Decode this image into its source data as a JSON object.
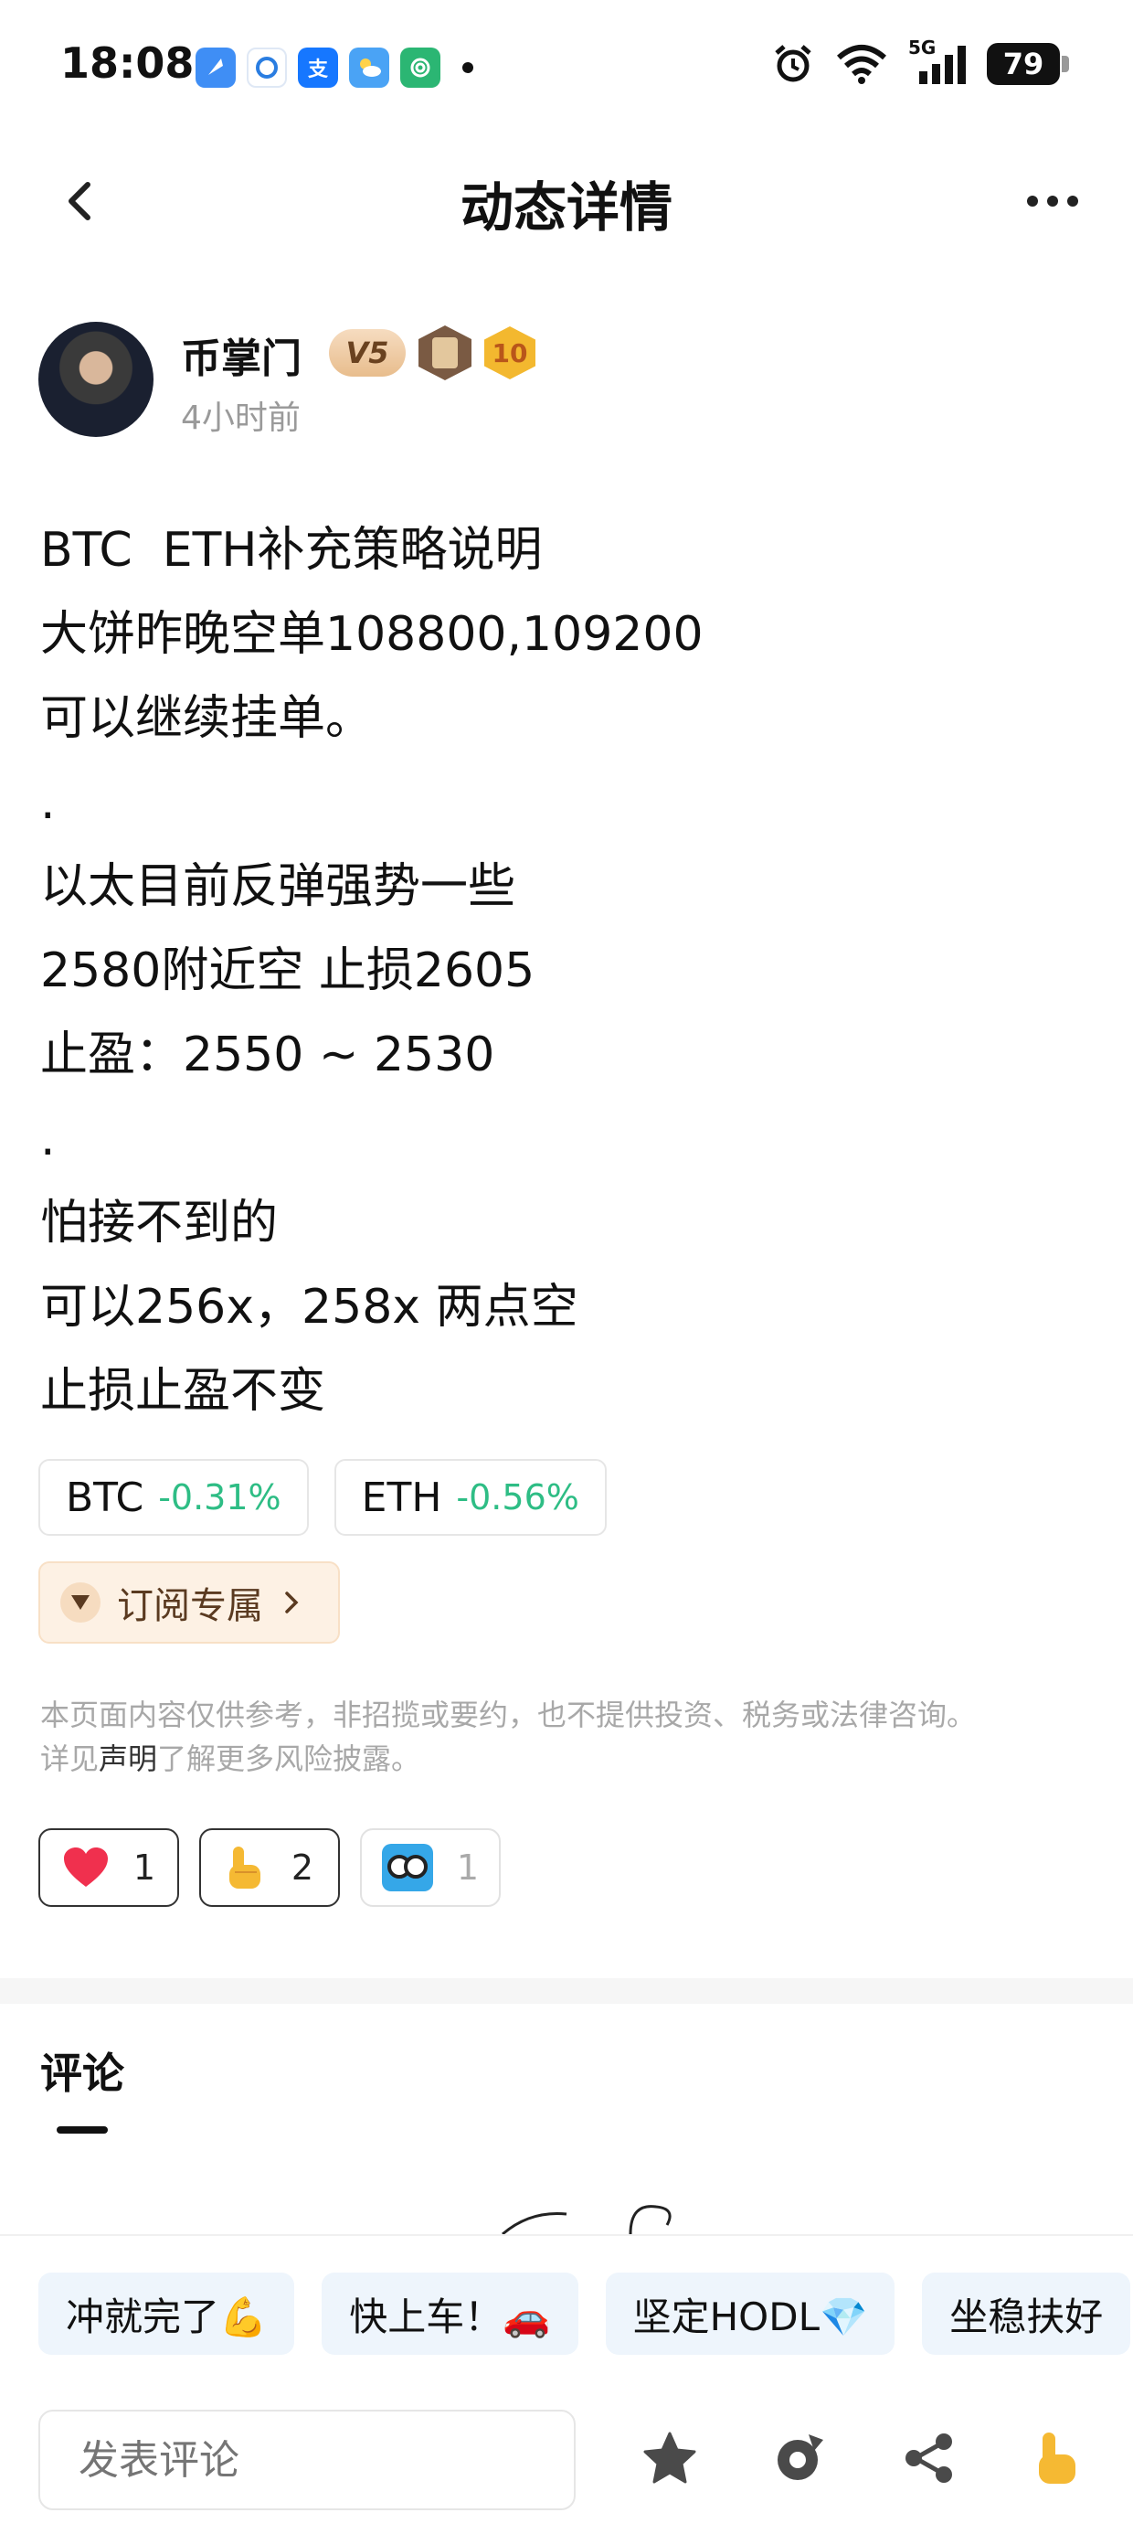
{
  "status_bar": {
    "time": "18:08",
    "battery": "79",
    "network": "5G",
    "app_icons": [
      "blue-feather-icon",
      "tongcheng-icon",
      "alipay-icon",
      "weather-icon",
      "fingerprint-icon"
    ]
  },
  "nav": {
    "title": "动态详情"
  },
  "author": {
    "name": "币掌门",
    "level_badge": "V5",
    "number_badge": "10",
    "time": "4小时前"
  },
  "post": {
    "lines": [
      "BTC  ETH补充策略说明",
      "大饼昨晚空单108800,109200",
      "可以继续挂单。",
      ".",
      "以太目前反弹强势一些",
      "2580附近空 止损2605",
      "止盈：2550 ~ 2530",
      ".",
      "怕接不到的",
      "可以256x，258x 两点空",
      "止损止盈不变"
    ]
  },
  "tickers": [
    {
      "symbol": "BTC",
      "change": "-0.31%"
    },
    {
      "symbol": "ETH",
      "change": "-0.56%"
    }
  ],
  "subscribe": {
    "label": "订阅专属"
  },
  "disclaimer": {
    "line1": "本页面内容仅供参考，非招揽或要约，也不提供投资、税务或法律咨询。",
    "line2_prefix": "详见",
    "line2_link": "声明",
    "line2_suffix": "了解更多风险披露。"
  },
  "reactions": [
    {
      "icon": "heart-icon",
      "count": "1"
    },
    {
      "icon": "thumbs-up-icon",
      "count": "2"
    },
    {
      "icon": "hodl-owl-icon",
      "count": "1"
    }
  ],
  "comments": {
    "title": "评论"
  },
  "quick_replies": [
    "冲就完了💪",
    "快上车！🚗",
    "坚定HODL💎",
    "坐稳扶好"
  ],
  "comment_input": {
    "placeholder": "发表评论"
  },
  "bottom_actions": [
    "star-icon",
    "repost-icon",
    "share-icon",
    "thumbs-up-icon"
  ],
  "colors": {
    "positive_green": "#2ebd85",
    "subscribe_bg": "#fdf1e4",
    "quick_reply_bg": "#eef5fc"
  }
}
